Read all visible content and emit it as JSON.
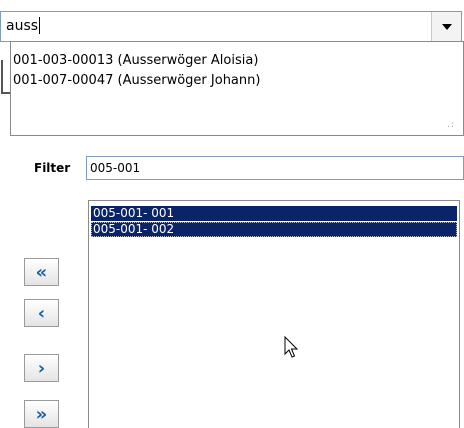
{
  "combo": {
    "value": "auss"
  },
  "dropdown": {
    "items": [
      "001-003-00013 (Ausserwöger Aloisia)",
      "001-007-00047 (Ausserwöger Johann)"
    ]
  },
  "filter": {
    "label": "Filter",
    "value": "005-001"
  },
  "list": {
    "items": [
      "005-001- 001",
      "005-001- 002"
    ]
  },
  "buttons": {
    "move_all_left": "«",
    "move_left": "‹",
    "move_right": "›",
    "move_all_right": "»"
  },
  "colors": {
    "selection": "#0a246a",
    "button_arrow": "#1a5fa8",
    "input_border": "#7f9db9"
  }
}
